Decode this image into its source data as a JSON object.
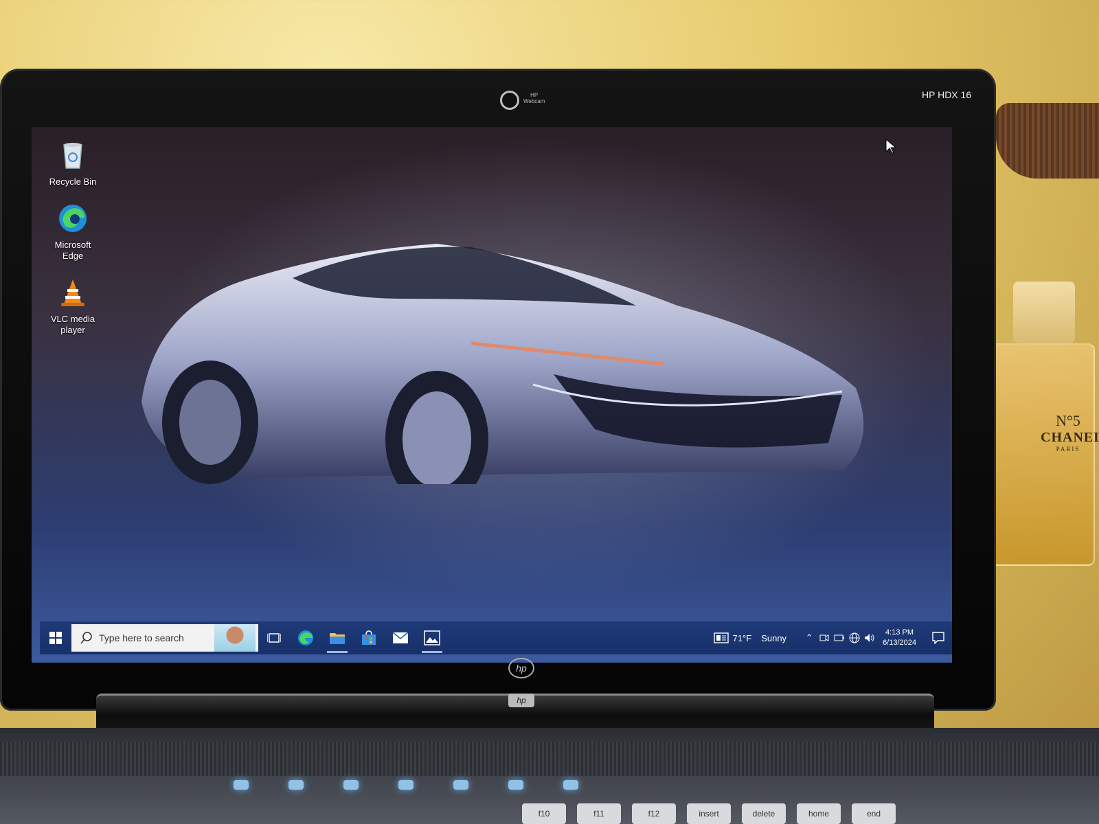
{
  "bezel": {
    "webcam_label_line1": "HP",
    "webcam_label_line2": "Webcam",
    "model": "HP HDX 16",
    "logo": "hp"
  },
  "desktop": {
    "icons": [
      {
        "label_line1": "Recycle Bin",
        "label_line2": "",
        "icon": "recycle-bin-icon"
      },
      {
        "label_line1": "Microsoft",
        "label_line2": "Edge",
        "icon": "edge-icon"
      },
      {
        "label_line1": "VLC media",
        "label_line2": "player",
        "icon": "vlc-icon"
      }
    ]
  },
  "taskbar": {
    "search_placeholder": "Type here to search",
    "apps": [
      "task-view-icon",
      "edge-icon",
      "file-explorer-icon",
      "store-icon",
      "mail-icon",
      "photos-icon"
    ],
    "weather": {
      "temp": "71°F",
      "condition": "Sunny"
    },
    "clock": {
      "time": "4:13 PM",
      "date": "6/13/2024"
    }
  },
  "keyboard": {
    "keys": [
      "f10",
      "f11",
      "f12",
      "insert",
      "delete",
      "home",
      "end"
    ]
  },
  "perfume": {
    "line1": "N°5",
    "line2": "CHANEL",
    "line3": "PARIS"
  },
  "colors": {
    "taskbar": "#1e3a78",
    "accent": "#9fb9e8"
  }
}
